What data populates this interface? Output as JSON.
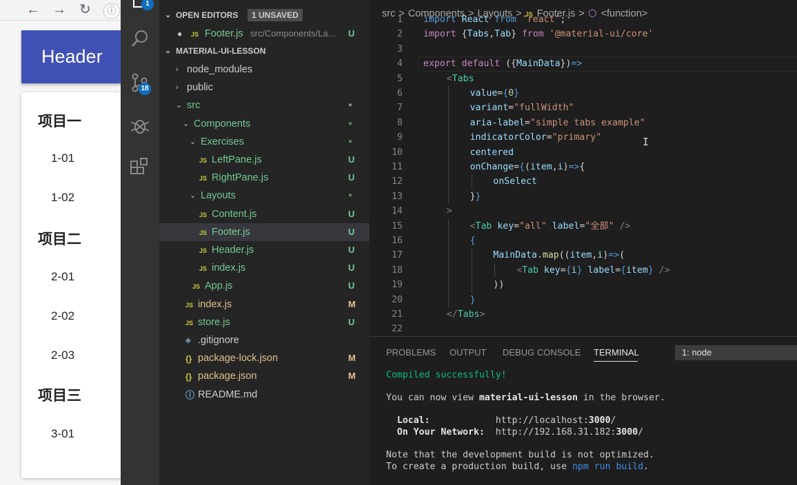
{
  "browser": {
    "nav": {
      "back": "←",
      "forward": "→",
      "reload": "↻"
    },
    "header": "Header",
    "items": [
      {
        "kind": "group",
        "text": "项目一"
      },
      {
        "kind": "item",
        "text": "1-01"
      },
      {
        "kind": "item",
        "text": "1-02"
      },
      {
        "kind": "group",
        "text": "项目二"
      },
      {
        "kind": "item",
        "text": "2-01"
      },
      {
        "kind": "item",
        "text": "2-02"
      },
      {
        "kind": "item",
        "text": "2-03"
      },
      {
        "kind": "group",
        "text": "项目三"
      },
      {
        "kind": "item",
        "text": "3-01"
      }
    ]
  },
  "activity": {
    "explorer_badge": "1",
    "scm_badge": "18"
  },
  "explorer": {
    "open_editors_title": "OPEN EDITORS",
    "unsaved": "1 UNSAVED",
    "open_file": {
      "name": "Footer.js",
      "path": "src/Components/La...",
      "status": "U"
    },
    "project_title": "MATERIAL-UI-LESSON",
    "tree": [
      {
        "label": "node_modules",
        "chevron": "›",
        "status": "",
        "icon": "",
        "indent": 0,
        "sel": false
      },
      {
        "label": "public",
        "chevron": "›",
        "status": "",
        "icon": "",
        "indent": 0,
        "sel": false
      },
      {
        "label": "src",
        "chevron": "⌄",
        "status": "●",
        "icon": "",
        "indent": 0,
        "sel": false
      },
      {
        "label": "Components",
        "chevron": "⌄",
        "status": "●",
        "icon": "",
        "indent": 1,
        "sel": false
      },
      {
        "label": "Exercises",
        "chevron": "⌄",
        "status": "●",
        "icon": "",
        "indent": 2,
        "sel": false
      },
      {
        "label": "LeftPane.js",
        "chevron": "",
        "status": "U",
        "icon": "JS",
        "indent": 3,
        "sel": false
      },
      {
        "label": "RightPane.js",
        "chevron": "",
        "status": "U",
        "icon": "JS",
        "indent": 3,
        "sel": false
      },
      {
        "label": "Layouts",
        "chevron": "⌄",
        "status": "●",
        "icon": "",
        "indent": 2,
        "sel": false
      },
      {
        "label": "Content.js",
        "chevron": "",
        "status": "U",
        "icon": "JS",
        "indent": 3,
        "sel": false
      },
      {
        "label": "Footer.js",
        "chevron": "",
        "status": "U",
        "icon": "JS",
        "indent": 3,
        "sel": true
      },
      {
        "label": "Header.js",
        "chevron": "",
        "status": "U",
        "icon": "JS",
        "indent": 3,
        "sel": false
      },
      {
        "label": "index.js",
        "chevron": "",
        "status": "U",
        "icon": "JS",
        "indent": 3,
        "sel": false
      },
      {
        "label": "App.js",
        "chevron": "",
        "status": "U",
        "icon": "JS",
        "indent": 2,
        "sel": false
      },
      {
        "label": "index.js",
        "chevron": "",
        "status": "M",
        "icon": "JS",
        "indent": 1,
        "sel": false
      },
      {
        "label": "store.js",
        "chevron": "",
        "status": "U",
        "icon": "JS",
        "indent": 1,
        "sel": false
      },
      {
        "label": ".gitignore",
        "chevron": "",
        "status": "",
        "icon": "◆",
        "indent": 1,
        "sel": false
      },
      {
        "label": "package-lock.json",
        "chevron": "",
        "status": "M",
        "icon": "{}",
        "indent": 1,
        "sel": false
      },
      {
        "label": "package.json",
        "chevron": "",
        "status": "M",
        "icon": "{}",
        "indent": 1,
        "sel": false
      },
      {
        "label": "README.md",
        "chevron": "",
        "status": "",
        "icon": "ⓘ",
        "indent": 1,
        "sel": false
      }
    ]
  },
  "editor": {
    "breadcrumb": {
      "segments": [
        "src",
        "Components",
        "Layouts"
      ],
      "file_icon": "JS",
      "file": "Footer.js",
      "symbol_icon": "⬡",
      "symbol": "<function>",
      "sep": ">"
    },
    "lines": [
      {
        "n": "1",
        "ind": 0,
        "tokens": [
          [
            "k",
            "import "
          ],
          [
            "a",
            "React"
          ],
          [
            "k",
            " from "
          ],
          [
            "s",
            "'react'"
          ],
          [
            "",
            "; "
          ]
        ]
      },
      {
        "n": "2",
        "ind": 0,
        "tokens": [
          [
            "kw",
            "import "
          ],
          [
            "",
            "{"
          ],
          [
            "a",
            "Tabs"
          ],
          [
            "",
            ","
          ],
          [
            "a",
            "Tab"
          ],
          [
            "",
            "} "
          ],
          [
            "kw",
            "from "
          ],
          [
            "s",
            "'@material-ui/core'"
          ]
        ]
      },
      {
        "n": "3",
        "ind": 0,
        "tokens": []
      },
      {
        "n": "4",
        "ind": 0,
        "tokens": [
          [
            "kw",
            "export "
          ],
          [
            "kw",
            "default "
          ],
          [
            "",
            "({"
          ],
          [
            "a",
            "MainData"
          ],
          [
            "",
            "})"
          ],
          [
            "k",
            "=>"
          ]
        ]
      },
      {
        "n": "5",
        "ind": 1,
        "tokens": [
          [
            "p",
            "<"
          ],
          [
            "t",
            "Tabs"
          ]
        ]
      },
      {
        "n": "6",
        "ind": 2,
        "tokens": [
          [
            "a",
            "value"
          ],
          [
            "",
            "="
          ],
          [
            "k",
            "{"
          ],
          [
            "n",
            "0"
          ],
          [
            "k",
            "}"
          ]
        ]
      },
      {
        "n": "7",
        "ind": 2,
        "tokens": [
          [
            "a",
            "variant"
          ],
          [
            "",
            "="
          ],
          [
            "s",
            "\"fullWidth\""
          ]
        ]
      },
      {
        "n": "8",
        "ind": 2,
        "tokens": [
          [
            "a",
            "aria-label"
          ],
          [
            "",
            "="
          ],
          [
            "s",
            "\"simple tabs example\""
          ]
        ]
      },
      {
        "n": "9",
        "ind": 2,
        "tokens": [
          [
            "a",
            "indicatorColor"
          ],
          [
            "",
            "="
          ],
          [
            "s",
            "\"primary\""
          ]
        ]
      },
      {
        "n": "10",
        "ind": 2,
        "tokens": [
          [
            "a",
            "centered"
          ]
        ]
      },
      {
        "n": "11",
        "ind": 2,
        "tokens": [
          [
            "a",
            "onChange"
          ],
          [
            "",
            "="
          ],
          [
            "k",
            "{"
          ],
          [
            "",
            "("
          ],
          [
            "a",
            "item"
          ],
          [
            "",
            ","
          ],
          [
            "a",
            "i"
          ],
          [
            "",
            ")"
          ],
          [
            "k",
            "=>"
          ],
          [
            "",
            "{"
          ]
        ]
      },
      {
        "n": "12",
        "ind": 3,
        "tokens": [
          [
            "a",
            "onSelect"
          ]
        ]
      },
      {
        "n": "13",
        "ind": 2,
        "tokens": [
          [
            "",
            "}"
          ],
          [
            "k",
            "}"
          ]
        ]
      },
      {
        "n": "14",
        "ind": 1,
        "tokens": [
          [
            "p",
            ">"
          ]
        ]
      },
      {
        "n": "15",
        "ind": 2,
        "tokens": [
          [
            "p",
            "<"
          ],
          [
            "t",
            "Tab "
          ],
          [
            "a",
            "key"
          ],
          [
            "",
            "="
          ],
          [
            "s",
            "\"all\" "
          ],
          [
            "a",
            "label"
          ],
          [
            "",
            "="
          ],
          [
            "s",
            "\"全部\" "
          ],
          [
            "p",
            "/>"
          ]
        ]
      },
      {
        "n": "16",
        "ind": 2,
        "tokens": [
          [
            "k",
            "{"
          ]
        ]
      },
      {
        "n": "17",
        "ind": 3,
        "tokens": [
          [
            "a",
            "MainData"
          ],
          [
            "",
            "."
          ],
          [
            "f",
            "map"
          ],
          [
            "",
            "(("
          ],
          [
            "a",
            "item"
          ],
          [
            "",
            ","
          ],
          [
            "a",
            "i"
          ],
          [
            "",
            ")"
          ],
          [
            "k",
            "=>"
          ],
          [
            "",
            "("
          ]
        ]
      },
      {
        "n": "18",
        "ind": 4,
        "tokens": [
          [
            "p",
            "<"
          ],
          [
            "t",
            "Tab "
          ],
          [
            "a",
            "key"
          ],
          [
            "",
            "="
          ],
          [
            "k",
            "{"
          ],
          [
            "a",
            "i"
          ],
          [
            "k",
            "} "
          ],
          [
            "a",
            "label"
          ],
          [
            "",
            "="
          ],
          [
            "k",
            "{"
          ],
          [
            "a",
            "item"
          ],
          [
            "k",
            "} "
          ],
          [
            "p",
            "/>"
          ]
        ]
      },
      {
        "n": "19",
        "ind": 3,
        "tokens": [
          [
            "",
            "))"
          ]
        ]
      },
      {
        "n": "20",
        "ind": 2,
        "tokens": [
          [
            "k",
            "}"
          ]
        ]
      },
      {
        "n": "21",
        "ind": 1,
        "tokens": [
          [
            "p",
            "</"
          ],
          [
            "t",
            "Tabs"
          ],
          [
            "p",
            ">"
          ]
        ]
      },
      {
        "n": "22",
        "ind": 0,
        "tokens": []
      }
    ]
  },
  "panel": {
    "tabs": [
      "PROBLEMS",
      "OUTPUT",
      "DEBUG CONSOLE",
      "TERMINAL"
    ],
    "active_tab": "TERMINAL",
    "terminal_select": "1: node",
    "terminal": {
      "compiled": "Compiled successfully!",
      "view_prefix": "You can now view ",
      "app_name": "material-ui-lesson",
      "view_suffix": " in the browser.",
      "local_label": "  Local:            ",
      "local_url_a": "http://localhost:",
      "local_port": "3000",
      "local_url_b": "/",
      "network_label": "  On Your Network:  ",
      "network_url_a": "http://192.168.31.182:",
      "network_port": "3000",
      "network_url_b": "/",
      "note1": "Note that the development build is not optimized.",
      "note2_prefix": "To create a production build, use ",
      "note2_cmd": "npm run build",
      "note2_suffix": "."
    }
  }
}
